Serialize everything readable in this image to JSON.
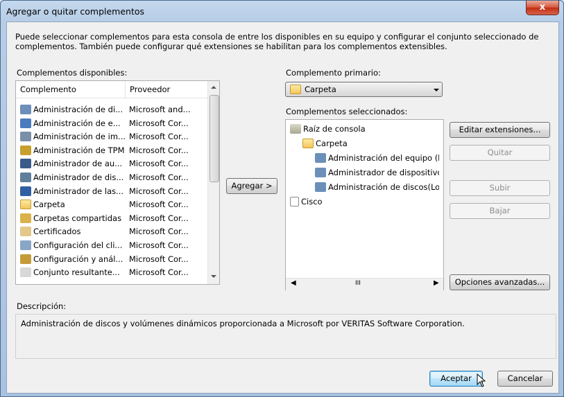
{
  "window": {
    "title": "Agregar o quitar complementos",
    "close_glyph": "x"
  },
  "intro_text": "Puede seleccionar complementos para esta consola de entre los disponibles en su equipo y configurar el conjunto seleccionado de complementos. También puede configurar qué extensiones se habilitan para los complementos extensibles.",
  "available": {
    "label": "Complementos disponibles:",
    "columns": [
      "Complemento",
      "Proveedor"
    ],
    "rows": [
      {
        "name": "Administración de di...",
        "vendor": "Microsoft and...",
        "icon": "disk-management-icon",
        "color": "#6b8fb8"
      },
      {
        "name": "Administración de e...",
        "vendor": "Microsoft Cor...",
        "icon": "computer-management-icon",
        "color": "#4a7bbd"
      },
      {
        "name": "Administración de im...",
        "vendor": "Microsoft Cor...",
        "icon": "print-management-icon",
        "color": "#7a8fa8"
      },
      {
        "name": "Administración de TPM",
        "vendor": "Microsoft Cor...",
        "icon": "tpm-chip-icon",
        "color": "#c9a02e"
      },
      {
        "name": "Administrador de au...",
        "vendor": "Microsoft Cor...",
        "icon": "authorization-manager-icon",
        "color": "#3a5a8a"
      },
      {
        "name": "Administrador de dis...",
        "vendor": "Microsoft Cor...",
        "icon": "device-manager-icon",
        "color": "#5f7f9c"
      },
      {
        "name": "Administrador de las...",
        "vendor": "Microsoft Cor...",
        "icon": "shield-icon",
        "color": "#2f5fa0"
      },
      {
        "name": "Carpeta",
        "vendor": "Microsoft Cor...",
        "icon": "folder-icon",
        "color": "#f4c65a"
      },
      {
        "name": "Carpetas compartidas",
        "vendor": "Microsoft Cor...",
        "icon": "shared-folders-icon",
        "color": "#d9b24a"
      },
      {
        "name": "Certificados",
        "vendor": "Microsoft Cor...",
        "icon": "certificate-icon",
        "color": "#e2c98a"
      },
      {
        "name": "Configuración del cli...",
        "vendor": "Microsoft Cor...",
        "icon": "client-config-icon",
        "color": "#8aa6c7"
      },
      {
        "name": "Configuración y anál...",
        "vendor": "Microsoft Cor...",
        "icon": "security-analysis-icon",
        "color": "#c59b3a"
      },
      {
        "name": "Conjunto resultante...",
        "vendor": "Microsoft Cor...",
        "icon": "document-icon",
        "color": "#d8d8d8"
      }
    ]
  },
  "add_button": "Agregar >",
  "primary": {
    "label": "Complemento primario:",
    "value": "Carpeta"
  },
  "selected": {
    "label": "Complementos seleccionados:",
    "tree": [
      {
        "text": "Raíz de consola",
        "icon": "console-root-icon",
        "level": 0
      },
      {
        "text": "Carpeta",
        "icon": "folder-icon",
        "level": 1
      },
      {
        "text": "Administración del equipo (lc",
        "icon": "computer-management-icon",
        "level": 2
      },
      {
        "text": "Administrador de dispositivo",
        "icon": "device-manager-icon",
        "level": 2
      },
      {
        "text": "Administración de discos(Loc",
        "icon": "disk-management-icon",
        "level": 2
      },
      {
        "text": "Cisco",
        "icon": "document-icon",
        "level": 0
      }
    ],
    "hscroll_glyph": "III"
  },
  "side_buttons": {
    "edit_extensions": "Editar extensiones...",
    "remove": "Quitar",
    "move_up": "Subir",
    "move_down": "Bajar",
    "advanced": "Opciones avanzadas..."
  },
  "description": {
    "label": "Descripción:",
    "text": "Administración de discos y volúmenes dinámicos proporcionada a Microsoft por VERITAS Software Corporation."
  },
  "footer": {
    "ok": "Aceptar",
    "cancel": "Cancelar"
  }
}
